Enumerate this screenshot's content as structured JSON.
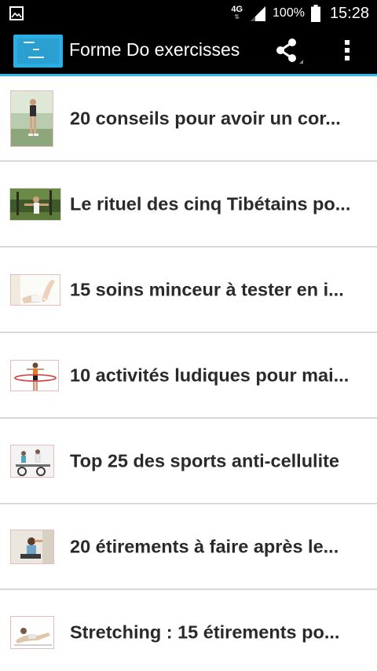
{
  "status_bar": {
    "left_icon": "gallery-notification-icon",
    "network_type": "4G",
    "network_arrows": "⇅",
    "signal_icon": "signal-icon",
    "battery_percent": "100%",
    "battery_icon": "battery-icon",
    "time": "15:28"
  },
  "app_bar": {
    "logo_icon": "app-logo-icon",
    "title": "Forme Do exercisses",
    "share_icon": "share-icon",
    "menu_icon": "overflow-menu-icon",
    "accent_color": "#33b5e5"
  },
  "articles": [
    {
      "title": "20 conseils pour avoir un cor...",
      "thumb_icon": "runner-thumbnail"
    },
    {
      "title": "Le rituel des cinq Tibétains po...",
      "thumb_icon": "yoga-outdoor-thumbnail"
    },
    {
      "title": "15 soins minceur à tester en i...",
      "thumb_icon": "legs-thumbnail"
    },
    {
      "title": "10 activités ludiques pour mai...",
      "thumb_icon": "hula-hoop-thumbnail"
    },
    {
      "title": "Top 25 des sports anti-cellulite",
      "thumb_icon": "spinning-class-thumbnail"
    },
    {
      "title": "20 étirements à faire après le...",
      "thumb_icon": "stretching-woman-thumbnail"
    },
    {
      "title": "Stretching : 15 étirements po...",
      "thumb_icon": "stretching-pose-thumbnail"
    }
  ]
}
